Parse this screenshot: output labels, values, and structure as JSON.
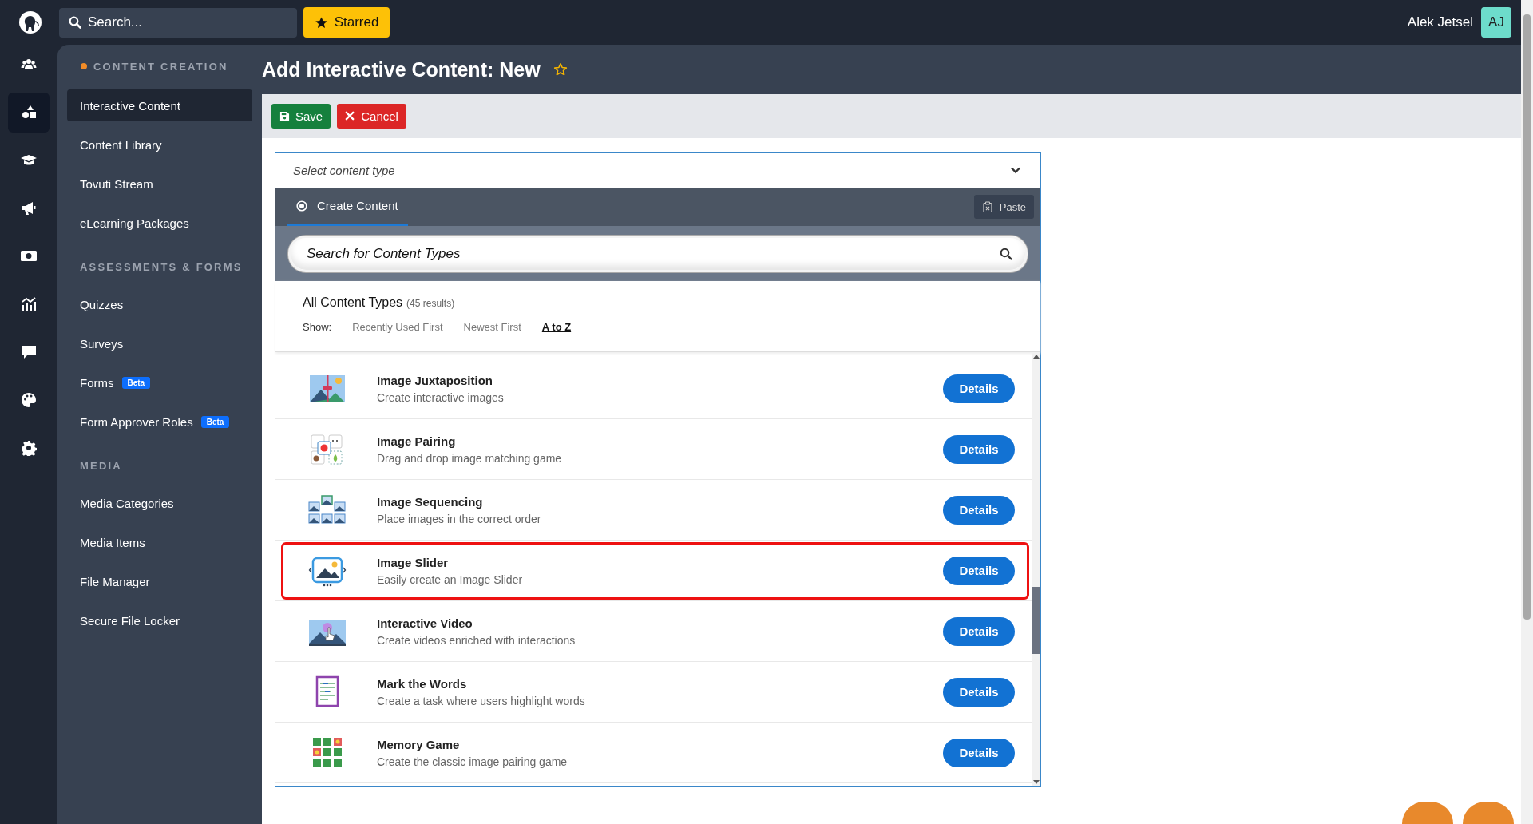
{
  "topbar": {
    "search": {
      "placeholder": "Search..."
    },
    "starred_button": "Starred",
    "user": {
      "name": "Alek Jetsel",
      "initials": "AJ"
    }
  },
  "rail": [
    {
      "kind": "users",
      "selected": false
    },
    {
      "kind": "shapes",
      "selected": true
    },
    {
      "kind": "graduation",
      "selected": false
    },
    {
      "kind": "megaphone",
      "selected": false
    },
    {
      "kind": "money",
      "selected": false
    },
    {
      "kind": "chart",
      "selected": false
    },
    {
      "kind": "chat",
      "selected": false
    },
    {
      "kind": "palette",
      "selected": false
    },
    {
      "kind": "gear",
      "selected": false
    }
  ],
  "sidebar": [
    {
      "heading": "CONTENT CREATION",
      "active": true,
      "items": [
        {
          "label": "Interactive Content",
          "selected": true
        },
        {
          "label": "Content Library",
          "selected": false
        },
        {
          "label": "Tovuti Stream",
          "selected": false
        },
        {
          "label": "eLearning Packages",
          "selected": false
        }
      ]
    },
    {
      "heading": "ASSESSMENTS & FORMS",
      "active": false,
      "items": [
        {
          "label": "Quizzes",
          "selected": false
        },
        {
          "label": "Surveys",
          "selected": false
        },
        {
          "label": "Forms",
          "selected": false,
          "badge": "Beta"
        },
        {
          "label": "Form Approver Roles",
          "selected": false,
          "badge": "Beta"
        }
      ]
    },
    {
      "heading": "MEDIA",
      "active": false,
      "items": [
        {
          "label": "Media Categories",
          "selected": false
        },
        {
          "label": "Media Items",
          "selected": false
        },
        {
          "label": "File Manager",
          "selected": false
        },
        {
          "label": "Secure File Locker",
          "selected": false
        }
      ]
    }
  ],
  "page": {
    "title": "Add Interactive Content: New",
    "starred": false,
    "toolbar": [
      {
        "label": "Save",
        "kind": "save"
      },
      {
        "label": "Cancel",
        "kind": "cancel"
      }
    ],
    "panel": {
      "select": {
        "placeholder": "Select content type"
      },
      "tab": {
        "label": "Create Content",
        "selected": true
      },
      "paste_button": "Paste",
      "search": {
        "placeholder": "Search for Content Types"
      },
      "results_title": "All Content Types",
      "results_count": "(45 results)",
      "sort": {
        "label": "Show:",
        "options": [
          {
            "label": "Recently Used First",
            "selected": false
          },
          {
            "label": "Newest First",
            "selected": false
          },
          {
            "label": "A to Z",
            "selected": true
          }
        ]
      },
      "items": [
        {
          "kind": "juxtaposition",
          "title": "Image Juxtaposition",
          "description": "Create interactive images",
          "button": "Details",
          "highlighted": false
        },
        {
          "kind": "pairing",
          "title": "Image Pairing",
          "description": "Drag and drop image matching game",
          "button": "Details",
          "highlighted": false
        },
        {
          "kind": "sequencing",
          "title": "Image Sequencing",
          "description": "Place images in the correct order",
          "button": "Details",
          "highlighted": false
        },
        {
          "kind": "slider",
          "title": "Image Slider",
          "description": "Easily create an Image Slider",
          "button": "Details",
          "highlighted": true
        },
        {
          "kind": "video",
          "title": "Interactive Video",
          "description": "Create videos enriched with interactions",
          "button": "Details",
          "highlighted": false
        },
        {
          "kind": "words",
          "title": "Mark the Words",
          "description": "Create a task where users highlight words",
          "button": "Details",
          "highlighted": false
        },
        {
          "kind": "memory",
          "title": "Memory Game",
          "description": "Create the classic image pairing game",
          "button": "Details",
          "highlighted": false
        }
      ]
    }
  }
}
